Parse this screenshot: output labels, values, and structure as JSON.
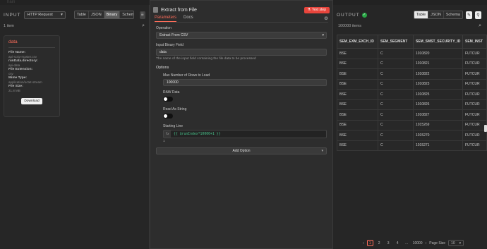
{
  "top": {
    "faint_text": "hain"
  },
  "input_panel": {
    "label": "INPUT",
    "source_node": "HTTP Request",
    "tabs": [
      "Table",
      "JSON",
      "Binary",
      "Schema"
    ],
    "active_tab": "Binary",
    "item_count": "1 item",
    "binary_card": {
      "title": "data",
      "file_name_label": "File Name:",
      "file_name": "api-scrip-master.csv",
      "directory_label": "runData.directory:",
      "directory": "api-data",
      "extension_label": "File Extension:",
      "extension": "csv",
      "mime_label": "Mime Type:",
      "mime": "application/octet-stream",
      "size_label": "File Size:",
      "size": "21.8 MB",
      "download_label": "Download"
    }
  },
  "node_modal": {
    "title": "Extract from File",
    "test_step_label": "Test step",
    "tabs": [
      "Parameters",
      "Docs"
    ],
    "active_tab": "Parameters",
    "operation_label": "Operation",
    "operation_value": "Extract From CSV",
    "binary_field_label": "Input Binary Field",
    "binary_field_value": "data",
    "binary_field_hint": "The name of the input field containing the file data to be processed",
    "options_label": "Options",
    "max_rows_label": "Max Number of Rows to Load",
    "max_rows_value": "100000",
    "raw_data_label": "RAW Data",
    "raw_data_enabled": false,
    "read_as_string_label": "Read As String",
    "read_as_string_enabled": false,
    "starting_line_label": "Starting Line",
    "fx_label": "fx",
    "starting_line_expr": "{{ $runIndex*10000+1 }}",
    "starting_line_result": "1",
    "add_option_label": "Add Option"
  },
  "output_panel": {
    "label": "OUTPUT",
    "tabs": [
      "Table",
      "JSON",
      "Schema"
    ],
    "active_tab": "Table",
    "item_count": "100000 items",
    "columns": [
      "SEM_EXM_EXCH_ID",
      "SEM_SEGMENT",
      "SEM_SMST_SECURITY_ID",
      "SEM_INST"
    ],
    "rows": [
      [
        "BSE",
        "C",
        "1010820",
        "FUTCUR"
      ],
      [
        "BSE",
        "C",
        "1010821",
        "FUTCUR"
      ],
      [
        "BSE",
        "C",
        "1010822",
        "FUTCUR"
      ],
      [
        "BSE",
        "C",
        "1010823",
        "FUTCUR"
      ],
      [
        "BSE",
        "C",
        "1010825",
        "FUTCUR"
      ],
      [
        "BSE",
        "C",
        "1010826",
        "FUTCUR"
      ],
      [
        "BSE",
        "C",
        "1010827",
        "FUTCUR"
      ],
      [
        "BSE",
        "C",
        "1015269",
        "FUTCUR"
      ],
      [
        "BSE",
        "C",
        "1015270",
        "FUTCUR"
      ],
      [
        "BSE",
        "C",
        "1015271",
        "FUTCUR"
      ]
    ],
    "pagination": {
      "pages": [
        "1",
        "2",
        "3",
        "4",
        "...",
        "10000"
      ],
      "active_page": "1",
      "page_size_label": "Page Size",
      "page_size_value": "10"
    }
  },
  "colors": {
    "accent": "#ff6d5a",
    "test_step": "#e8453c",
    "success": "#28a745",
    "expr": "#47c28a"
  }
}
